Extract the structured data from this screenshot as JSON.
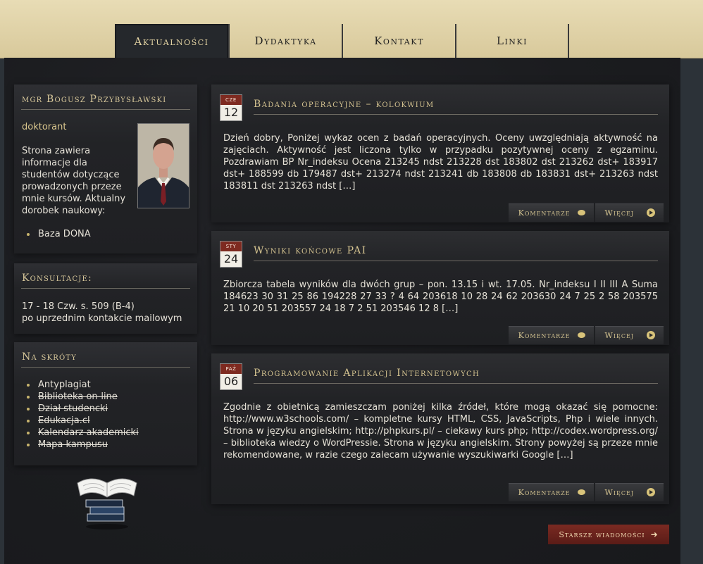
{
  "nav": [
    "Aktualności",
    "Dydaktyka",
    "Kontakt",
    "Linki"
  ],
  "profile": {
    "title": "mgr Bogusz Przybysławski",
    "role": "doktorant",
    "description": "Strona zawiera informacje dla studentów dotyczące prowadzonych przeze mnie kursów. Aktualny dorobek naukowy:",
    "links": [
      "Baza DONA"
    ]
  },
  "consult": {
    "title": "Konsultacje:",
    "line1": "17 - 18 Czw. s. 509 (B-4)",
    "line2": "po uprzednim kontakcie mailowym"
  },
  "shortcuts": {
    "title": "Na skróty",
    "items": [
      "Antyplagiat",
      "Biblioteka on-line",
      "Dział studencki",
      "Edukacja.cl",
      "Kalendarz akademicki",
      "Mapa kampusu"
    ]
  },
  "posts": [
    {
      "month": "CZE",
      "day": "12",
      "title": "Badania operacyjne – kolokwium",
      "body": "Dzień dobry, Poniżej wykaz ocen z badań operacyjnych. Oceny uwzględniają aktywność na zajęciach. Aktywność jest liczona tylko w przypadku pozytywnej oceny z egzaminu. Pozdrawiam BP Nr_indeksu Ocena 213245 ndst 213228 dst 183802 dst 213262 dst+ 183917 dst+ 188599 db 179487 dst+ 213274 ndst 213241 db 183808 db 183831 dst+ 213263 ndst 183811 dst 213263 ndst […]"
    },
    {
      "month": "STY",
      "day": "24",
      "title": "Wyniki końcowe PAI",
      "body": "Zbiorcza tabela wyników dla dwóch grup – pon. 13.15 i wt. 17.05.   Nr_indeksu I II III A Suma 184623 30 31 25 86 194228 27 33 ? 4 64 203618 10 28 24 62 203630 24 7 25 2 58 203575 21 10 20 51 203557 24 18 7 2 51 203546 12 8 […]"
    },
    {
      "month": "PAŹ",
      "day": "06",
      "title": "Programowanie Aplikacji Internetowych",
      "body": "Zgodnie z obietnicą zamieszczam poniżej kilka źródeł, które mogą okazać się pomocne: http://www.w3schools.com/ – kompletne kursy HTML, CSS, JavaScripts, Php i wiele innych. Strona w języku angielskim; http://phpkurs.pl/ – ciekawy kurs php; http://codex.wordpress.org/ – biblioteka wiedzy o WordPressie. Strona w języku angielskim. Strony powyżej są przeze mnie rekomendowane, w razie czego zalecam używanie wyszukiwarki Google […]"
    }
  ],
  "buttons": {
    "comments": "Komentarze",
    "more": "Więcej",
    "older": "Starsze wiadomości"
  }
}
